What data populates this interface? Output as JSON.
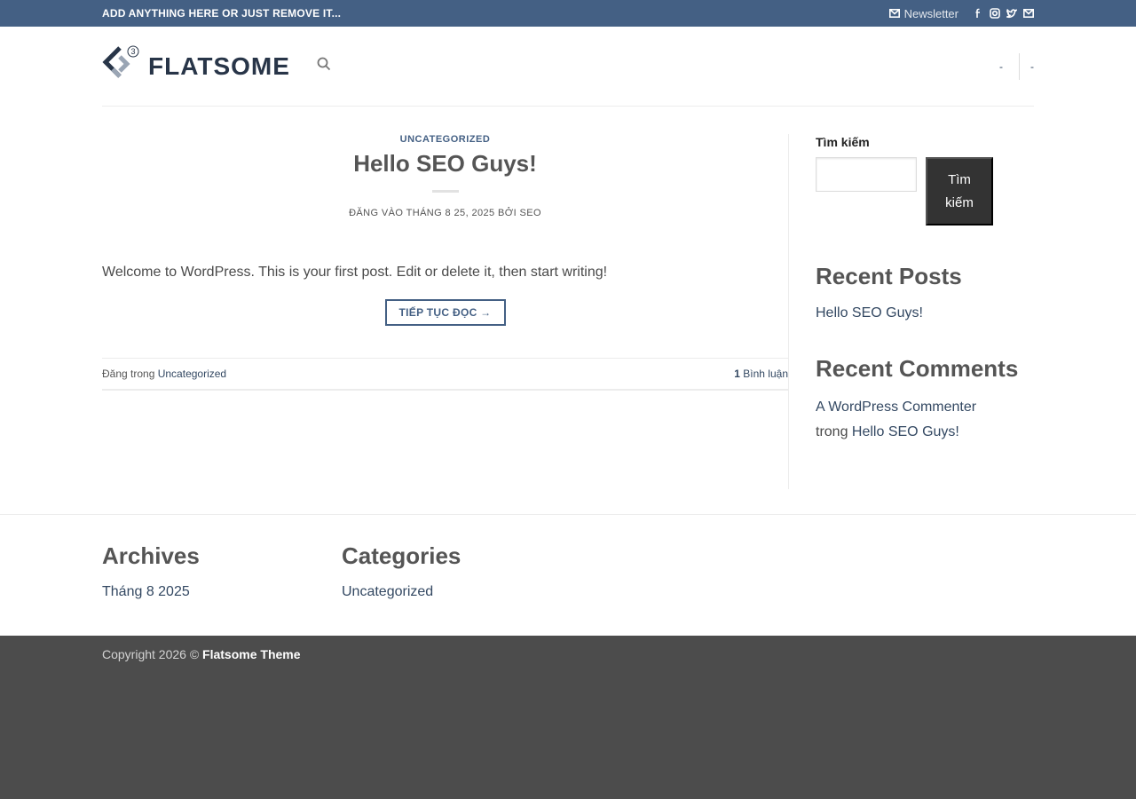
{
  "topbar": {
    "message": "ADD ANYTHING HERE OR JUST REMOVE IT...",
    "newsletter_label": "Newsletter",
    "social_icons": [
      "facebook-icon",
      "instagram-icon",
      "twitter-icon",
      "email-icon"
    ]
  },
  "header": {
    "logo_text": "FLATSOME",
    "logo_badge": "3",
    "nav_right": [
      "-",
      "-"
    ]
  },
  "post": {
    "category": "UNCATEGORIZED",
    "title": "Hello SEO Guys!",
    "meta": "ĐĂNG VÀO THÁNG 8 25, 2025 BỞI SEO",
    "excerpt": "Welcome to WordPress. This is your first post. Edit or delete it, then start writing!",
    "read_more": "TIẾP TỤC ĐỌC →",
    "footer_prefix": "Đăng trong",
    "footer_category": "Uncategorized",
    "comment_count": "1",
    "comment_label": "Bình luận"
  },
  "sidebar": {
    "search_title": "Tìm kiếm",
    "search_button": "Tìm kiếm",
    "recent_posts_title": "Recent Posts",
    "recent_posts": [
      "Hello SEO Guys!"
    ],
    "recent_comments_title": "Recent Comments",
    "comment_author": "A WordPress Commenter",
    "comment_on": "trong",
    "comment_post": "Hello SEO Guys!"
  },
  "footer_widgets": {
    "archives_title": "Archives",
    "archives_item": "Tháng 8 2025",
    "categories_title": "Categories",
    "categories_item": "Uncategorized"
  },
  "copyright": {
    "prefix": "Copyright 2026 ©",
    "brand": "Flatsome Theme"
  },
  "colors": {
    "topbar_bg": "#446084",
    "link": "#334862",
    "footer_bg": "#4c4c4c"
  }
}
